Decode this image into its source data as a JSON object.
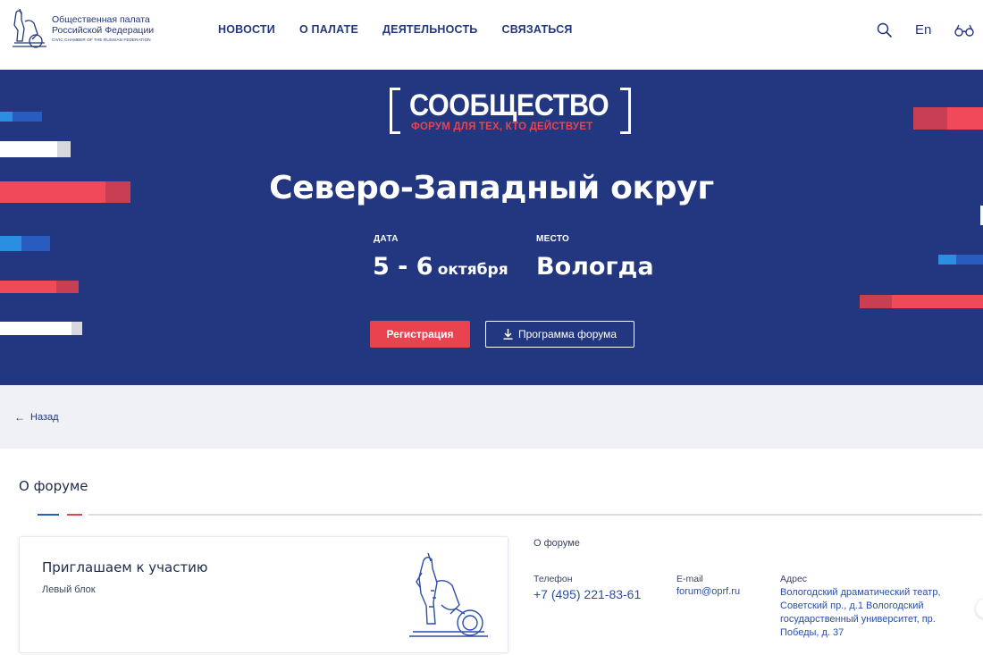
{
  "header": {
    "logo_line1": "Общественная палата",
    "logo_line2": "Российской Федерации",
    "logo_line3": "CIVIC CHAMBER OF THE RUSSIAN FEDERATION",
    "nav": [
      "НОВОСТИ",
      "О ПАЛАТЕ",
      "ДЕЯТЕЛЬНОСТЬ",
      "СВЯЗАТЬСЯ"
    ],
    "lang": "En",
    "icons": [
      "search-icon",
      "glasses-icon"
    ]
  },
  "hero": {
    "brand_word": "СООБЩЕСТВО",
    "brand_tag": "ФОРУМ ДЛЯ ТЕХ, КТО ДЕЙСТВУЕТ",
    "title": "Северо-Западный округ",
    "date_label": "ДАТА",
    "date_days": "5 - 6",
    "date_month": "октября",
    "place_label": "МЕСТО",
    "place": "Вологда",
    "register_button": "Регистрация",
    "program_button": "Программа форума"
  },
  "back": "Назад",
  "section": {
    "title": "О форуме",
    "card_title": "Приглашаем к участию",
    "card_sub": "Левый блок",
    "right_head": "О форуме",
    "phone_label": "Телефон",
    "phone": "+7 (495) 221-83-61",
    "email_label": "E-mail",
    "email": "forum@oprf.ru",
    "address_label": "Адрес",
    "address": "Вологодский драматический театр, Советский пр., д.1 Вологодский государственный университет, пр. Победы, д. 37"
  },
  "colors": {
    "navy": "#233780",
    "red": "#e8434f",
    "blue": "#2a5bbf",
    "light_bg": "#eff1f4"
  }
}
